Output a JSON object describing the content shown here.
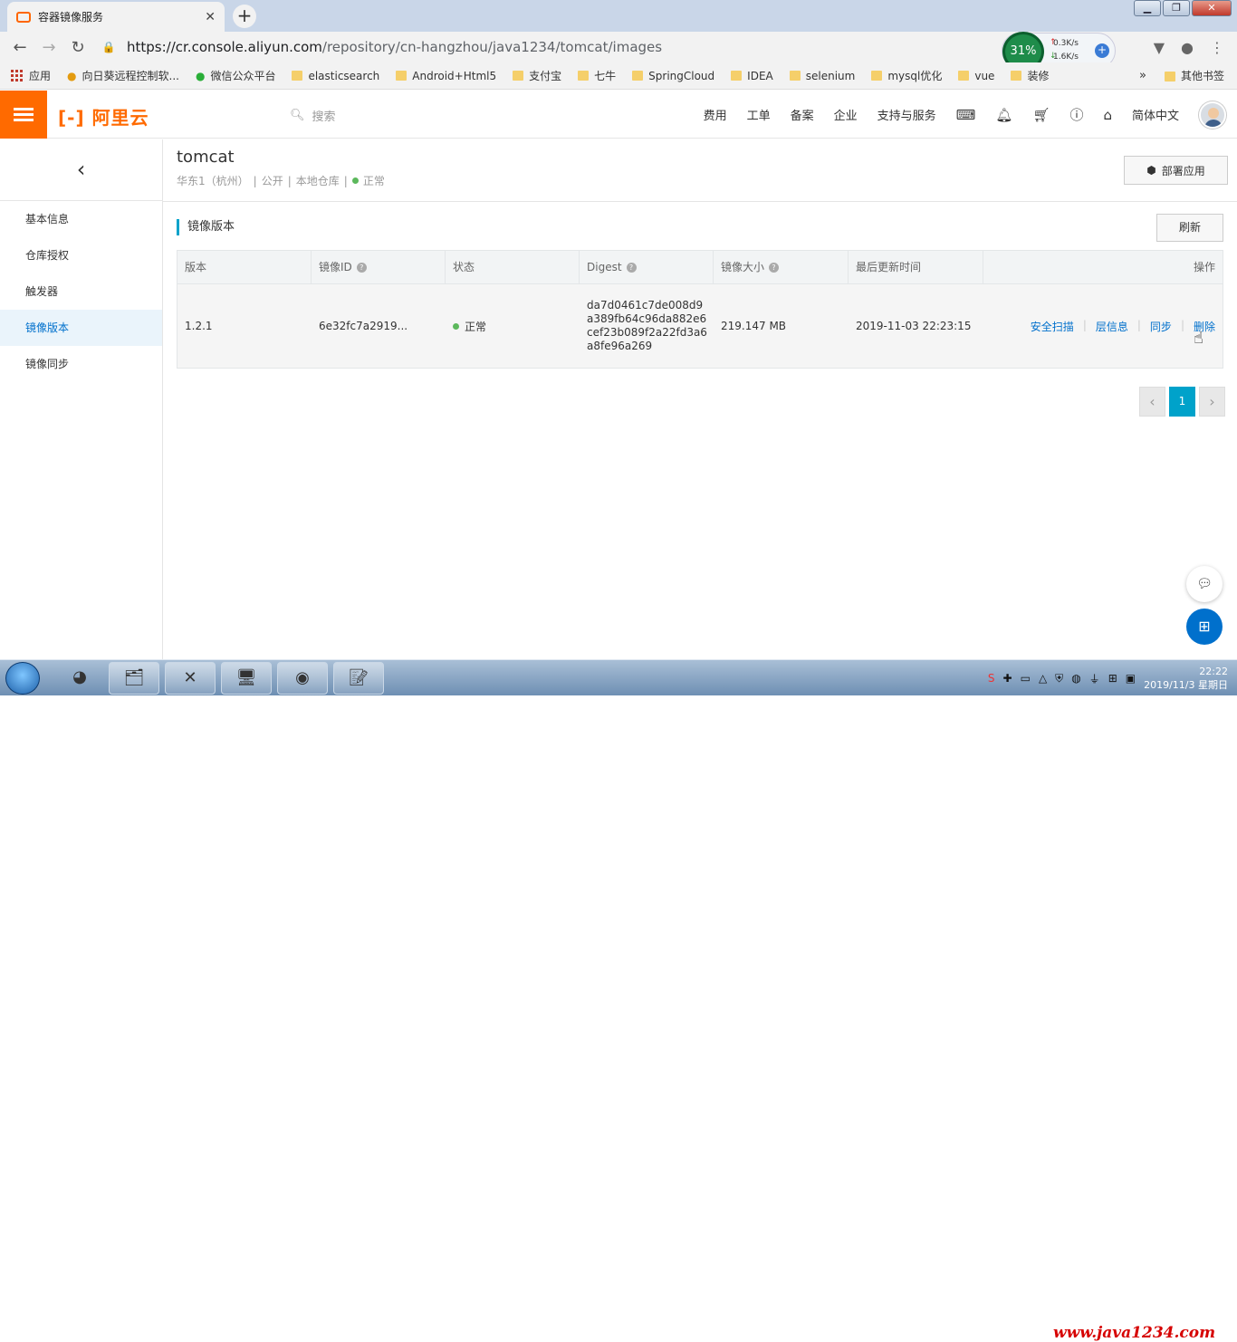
{
  "browser": {
    "tab_title": "容器镜像服务",
    "url_host": "https://cr.console.aliyun.com",
    "url_path": "/repository/cn-hangzhou/java1234/tomcat/images",
    "net_percent": "31%",
    "net_up": "0.3K/s",
    "net_down": "1.6K/s"
  },
  "bookmarks": [
    {
      "label": "应用",
      "icon": "apps-icon"
    },
    {
      "label": "向日葵远程控制软...",
      "icon": "sunflower-icon"
    },
    {
      "label": "微信公众平台",
      "icon": "wechat-icon"
    },
    {
      "label": "elasticsearch",
      "icon": "folder-icon"
    },
    {
      "label": "Android+Html5",
      "icon": "folder-icon"
    },
    {
      "label": "支付宝",
      "icon": "folder-icon"
    },
    {
      "label": "七牛",
      "icon": "folder-icon"
    },
    {
      "label": "SpringCloud",
      "icon": "folder-icon"
    },
    {
      "label": "IDEA",
      "icon": "folder-icon"
    },
    {
      "label": "selenium",
      "icon": "folder-icon"
    },
    {
      "label": "mysql优化",
      "icon": "folder-icon"
    },
    {
      "label": "vue",
      "icon": "folder-icon"
    },
    {
      "label": "装修",
      "icon": "folder-icon"
    }
  ],
  "bookmarks_more": "»",
  "bookmarks_other": "其他书签",
  "console": {
    "logo_text": "阿里云",
    "search_placeholder": "搜索",
    "nav": [
      "费用",
      "工单",
      "备案",
      "企业",
      "支持与服务"
    ],
    "language": "简体中文"
  },
  "sidebar": {
    "items": [
      "基本信息",
      "仓库授权",
      "触发器",
      "镜像版本",
      "镜像同步"
    ],
    "active": "镜像版本"
  },
  "repo": {
    "name": "tomcat",
    "region": "华东1（杭州）",
    "visibility": "公开",
    "source": "本地仓库",
    "status": "正常",
    "deploy_label": "部署应用"
  },
  "section": {
    "title": "镜像版本",
    "refresh_label": "刷新"
  },
  "table": {
    "headers": [
      "版本",
      "镜像ID",
      "状态",
      "Digest",
      "镜像大小",
      "最后更新时间",
      "操作"
    ],
    "rows": [
      {
        "version": "1.2.1",
        "image_id": "6e32fc7a2919...",
        "status": "正常",
        "digest": "da7d0461c7de008d9a389fb64c96da882e6cef23b089f2a22fd3a6a8fe96a269",
        "size": "219.147 MB",
        "updated": "2019-11-03 22:23:15",
        "actions": [
          "安全扫描",
          "层信息",
          "同步",
          "删除"
        ]
      }
    ]
  },
  "pagination": {
    "current": "1"
  },
  "colors": {
    "brand": "#ff6a00",
    "accent": "#00a2ca",
    "link": "#0070cc",
    "status_ok": "#5cb85c"
  },
  "taskbar": {
    "clock_time": "22:22",
    "clock_date": "2019/11/3 星期日",
    "watermark": "www.java1234.com"
  }
}
